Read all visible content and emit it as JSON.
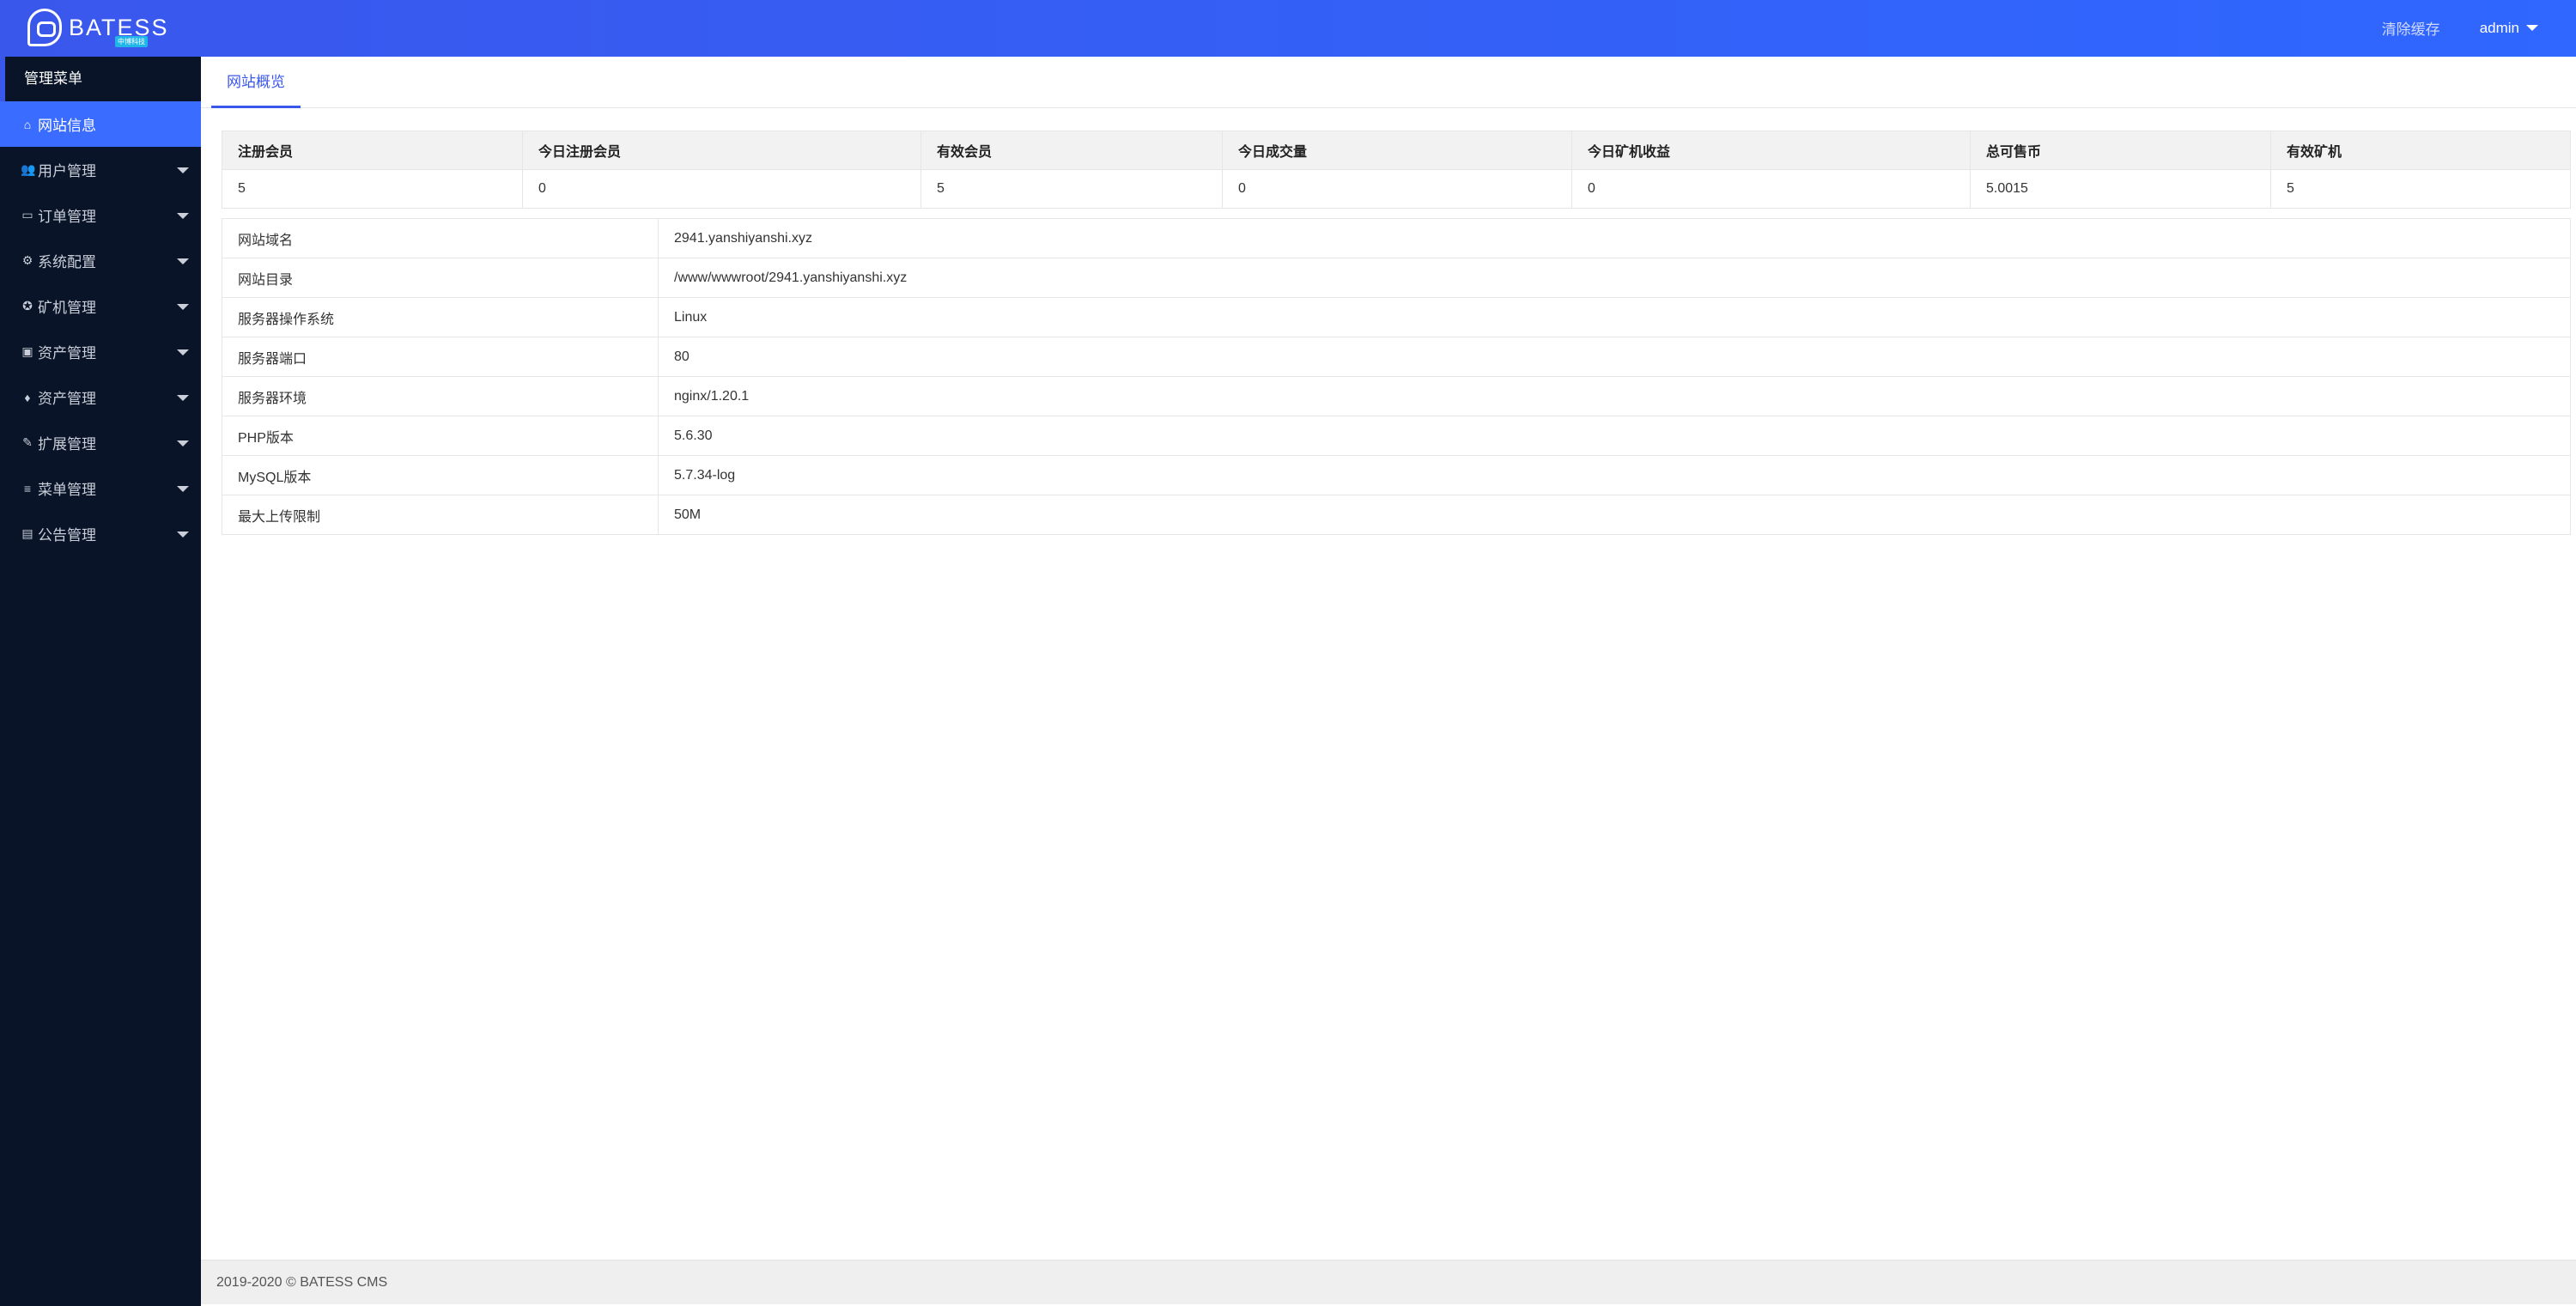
{
  "header": {
    "brand": "BATESS",
    "brand_sub": "中博科技",
    "clear_cache": "清除缓存",
    "user": "admin"
  },
  "sidebar": {
    "title": "管理菜单",
    "items": [
      {
        "label": "网站信息",
        "icon": "home-icon"
      },
      {
        "label": "用户管理",
        "icon": "users-icon"
      },
      {
        "label": "订单管理",
        "icon": "card-icon"
      },
      {
        "label": "系统配置",
        "icon": "cogs-icon"
      },
      {
        "label": "矿机管理",
        "icon": "rebel-icon"
      },
      {
        "label": "资产管理",
        "icon": "money-icon"
      },
      {
        "label": "资产管理",
        "icon": "diamond-icon"
      },
      {
        "label": "扩展管理",
        "icon": "wrench-icon"
      },
      {
        "label": "菜单管理",
        "icon": "bars-icon"
      },
      {
        "label": "公告管理",
        "icon": "file-icon"
      }
    ]
  },
  "main": {
    "tab": "网站概览",
    "stats": {
      "headers": [
        "注册会员",
        "今日注册会员",
        "有效会员",
        "今日成交量",
        "今日矿机收益",
        "总可售币",
        "有效矿机"
      ],
      "values": [
        "5",
        "0",
        "5",
        "0",
        "0",
        "5.0015",
        "5"
      ]
    },
    "info": [
      {
        "key": "网站域名",
        "value": "2941.yanshiyanshi.xyz"
      },
      {
        "key": "网站目录",
        "value": "/www/wwwroot/2941.yanshiyanshi.xyz"
      },
      {
        "key": "服务器操作系统",
        "value": "Linux"
      },
      {
        "key": "服务器端口",
        "value": "80"
      },
      {
        "key": "服务器环境",
        "value": "nginx/1.20.1"
      },
      {
        "key": "PHP版本",
        "value": "5.6.30"
      },
      {
        "key": "MySQL版本",
        "value": "5.7.34-log"
      },
      {
        "key": "最大上传限制",
        "value": "50M"
      }
    ]
  },
  "footer": {
    "text": "2019-2020 © BATESS CMS"
  }
}
